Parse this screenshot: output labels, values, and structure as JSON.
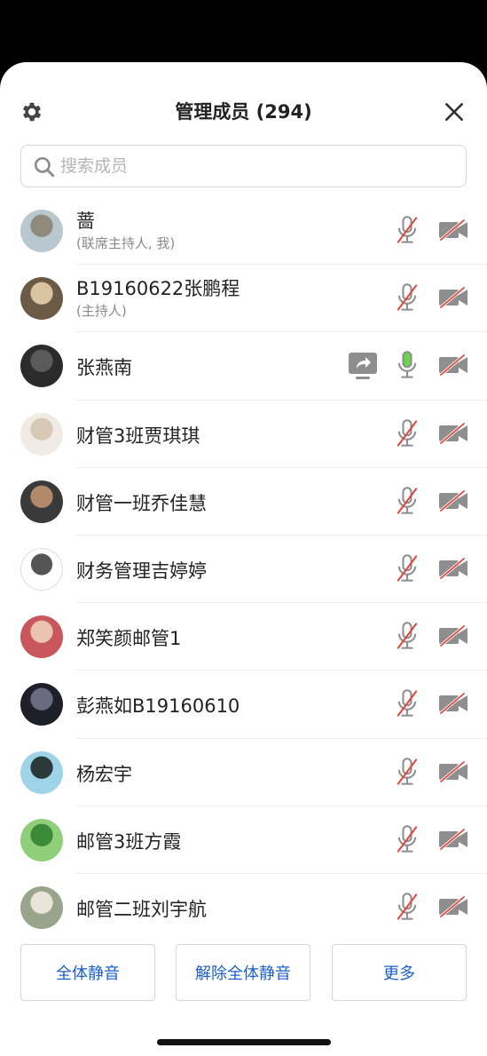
{
  "header": {
    "title": "管理成员 (294)"
  },
  "search": {
    "placeholder": "搜索成员",
    "value": ""
  },
  "members": [
    {
      "name": "蔷",
      "role": "(联席主持人, 我)",
      "mic": "muted",
      "camera": "off",
      "sharing": false
    },
    {
      "name": "B19160622张鹏程",
      "role": "(主持人)",
      "mic": "muted",
      "camera": "off",
      "sharing": false
    },
    {
      "name": "张燕南",
      "role": "",
      "mic": "active",
      "camera": "off",
      "sharing": true
    },
    {
      "name": "财管3班贾琪琪",
      "role": "",
      "mic": "muted",
      "camera": "off",
      "sharing": false
    },
    {
      "name": "财管一班乔佳慧",
      "role": "",
      "mic": "muted",
      "camera": "off",
      "sharing": false
    },
    {
      "name": "财务管理吉婷婷",
      "role": "",
      "mic": "muted",
      "camera": "off",
      "sharing": false
    },
    {
      "name": "郑笑颜邮管1",
      "role": "",
      "mic": "muted",
      "camera": "off",
      "sharing": false
    },
    {
      "name": "彭燕如B19160610",
      "role": "",
      "mic": "muted",
      "camera": "off",
      "sharing": false
    },
    {
      "name": "杨宏宇",
      "role": "",
      "mic": "muted",
      "camera": "off",
      "sharing": false
    },
    {
      "name": "邮管3班方霞",
      "role": "",
      "mic": "muted",
      "camera": "off",
      "sharing": false
    },
    {
      "name": "邮管二班刘宇航",
      "role": "",
      "mic": "muted",
      "camera": "off",
      "sharing": false
    }
  ],
  "buttons": {
    "mute_all": "全体静音",
    "unmute_all": "解除全体静音",
    "more": "更多"
  },
  "colors": {
    "accent": "#1d5fc9",
    "muted_slash": "#e0483e",
    "active_mic": "#6cd34a",
    "icon_gray": "#8e8e8e"
  },
  "icons": {
    "settings": "gear-icon",
    "close": "close-icon",
    "search": "search-icon",
    "mic_muted": "mic-muted-icon",
    "mic_active": "mic-active-icon",
    "camera_off": "camera-off-icon",
    "share": "screen-share-icon"
  }
}
